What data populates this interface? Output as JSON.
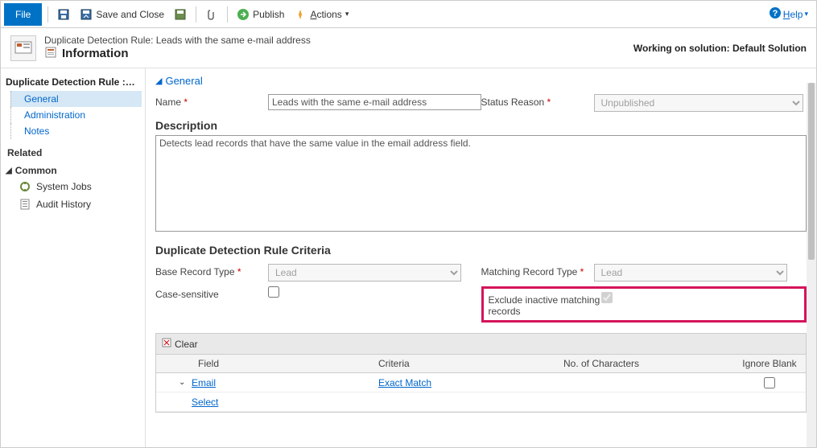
{
  "toolbar": {
    "file": "File",
    "save_close": "Save and Close",
    "publish": "Publish",
    "actions": "Actions",
    "help": "Help"
  },
  "header": {
    "path": "Duplicate Detection Rule: Leads with the same e-mail address",
    "title": "Information",
    "right": "Working on solution: Default Solution"
  },
  "sidebar": {
    "crumb": "Duplicate Detection Rule :…",
    "items": [
      {
        "label": "General",
        "active": true
      },
      {
        "label": "Administration"
      },
      {
        "label": "Notes"
      }
    ],
    "related": "Related",
    "common": "Common",
    "common_items": [
      {
        "label": "System Jobs"
      },
      {
        "label": "Audit History"
      }
    ]
  },
  "form": {
    "section_general": "General",
    "name_label": "Name",
    "name_value": "Leads with the same e-mail address",
    "status_label": "Status Reason",
    "status_value": "Unpublished",
    "description_label": "Description",
    "description_value": "Detects lead records that have the same value in the email address field.",
    "criteria_header": "Duplicate Detection Rule Criteria",
    "base_type_label": "Base Record Type",
    "base_type_value": "Lead",
    "match_type_label": "Matching Record Type",
    "match_type_value": "Lead",
    "case_sensitive_label": "Case-sensitive",
    "exclude_inactive_label": "Exclude inactive matching records"
  },
  "grid": {
    "clear": "Clear",
    "col_field": "Field",
    "col_criteria": "Criteria",
    "col_chars": "No. of Characters",
    "col_ignore": "Ignore Blank",
    "rows": [
      {
        "field": "Email",
        "criteria": "Exact Match"
      }
    ],
    "select": "Select"
  }
}
